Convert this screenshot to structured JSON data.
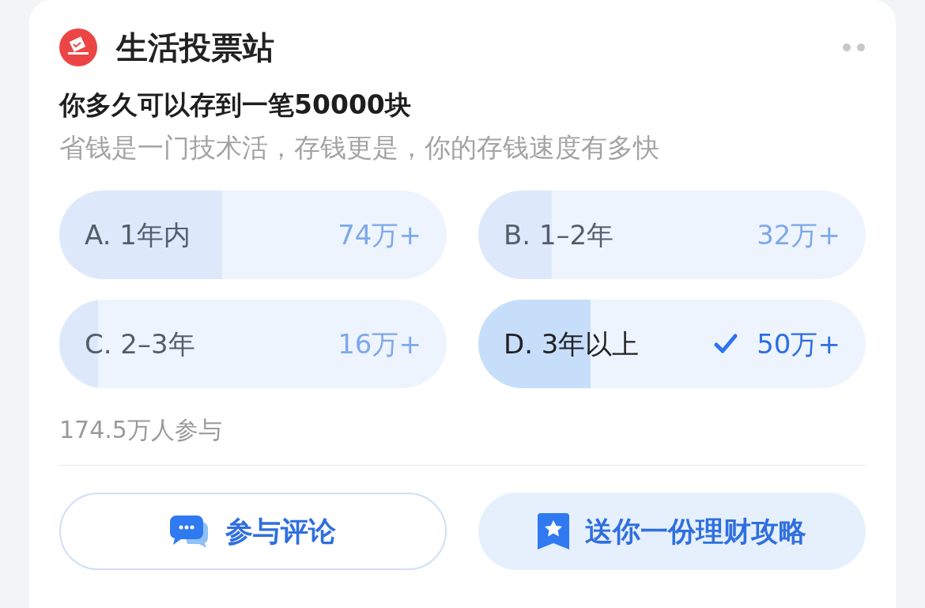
{
  "header": {
    "title": "生活投票站"
  },
  "question": {
    "title": "你多久可以存到一笔50000块",
    "subtitle": "省钱是一门技术活，存钱更是，你的存钱速度有多快"
  },
  "options": [
    {
      "label": "A. 1年内",
      "count": "74万+",
      "level": 0.42,
      "selected": false
    },
    {
      "label": "B. 1–2年",
      "count": "32万+",
      "level": 0.19,
      "selected": false
    },
    {
      "label": "C. 2–3年",
      "count": "16万+",
      "level": 0.1,
      "selected": false
    },
    {
      "label": "D. 3年以上",
      "count": "50万+",
      "level": 0.29,
      "selected": true
    }
  ],
  "participants": "174.5万人参与",
  "buttons": [
    {
      "kind": "comment",
      "label": "参与评论"
    },
    {
      "kind": "guide",
      "label": "送你一份理财攻略"
    }
  ]
}
